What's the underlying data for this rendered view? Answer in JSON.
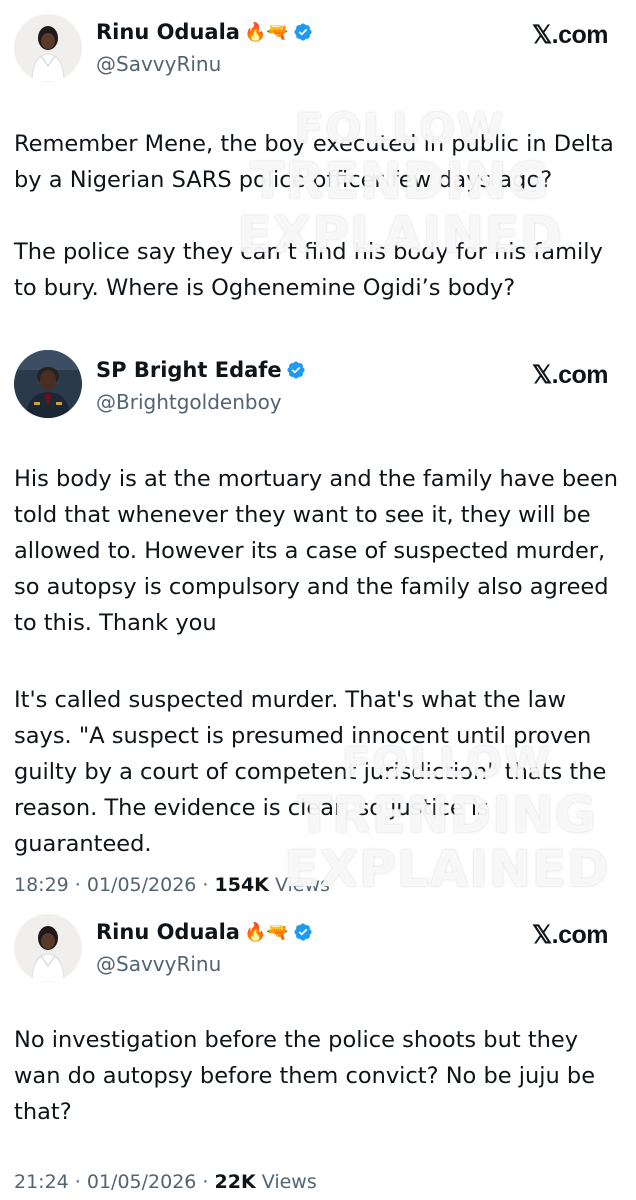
{
  "brand_label": "𝕏.com",
  "tweets": [
    {
      "author_name": "Rinu Oduala",
      "emojis": "🔥🔫",
      "handle": "@SavvyRinu",
      "text": "Remember Mene, the boy executed in public in Delta by a Nigerian SARS police officer few days ago?\n\nThe police say they can’t find his body for his family to bury. Where is Oghenemine Ogidi’s body?"
    },
    {
      "author_name": "SP Bright Edafe",
      "handle": "@Brightgoldenboy",
      "text": "His body is at the mortuary and the family have been told that whenever they want to see it, they will be allowed to. However its a case of suspected murder, so autopsy is compulsory and the family also agreed to this. Thank you",
      "text2": "It's called suspected murder. That's what the law says. \"A suspect is presumed innocent until proven guilty by a court of competent jurisdiction\" thats the reason. The evidence is clear, so justice is guaranteed.",
      "time": "18:29 · 01/05/2026 · ",
      "views_count": "154K",
      "views_label": "Views"
    },
    {
      "author_name": "Rinu Oduala",
      "emojis": "🔥🔫",
      "handle": "@SavvyRinu",
      "text": "No investigation before the police shoots but they wan do autopsy before them convict? No be juju be that?",
      "time": "21:24 · 01/05/2026 · ",
      "views_count": "22K",
      "views_label": "Views"
    }
  ],
  "watermark": {
    "line1": "FOLLOW",
    "line2": "TRENDING",
    "line3": "EXPLAINED"
  },
  "colors": {
    "text": "#0f1419",
    "secondary": "#536471",
    "verified": "#1d9bf0"
  }
}
